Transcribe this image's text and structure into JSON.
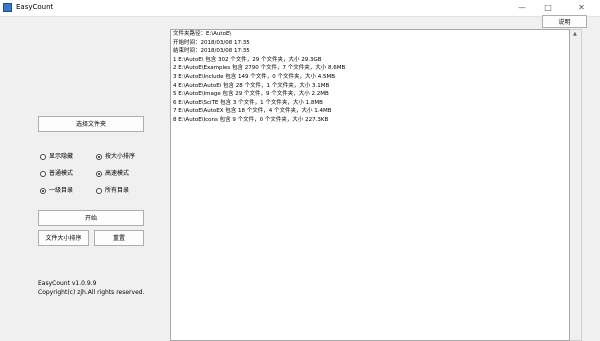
{
  "window": {
    "title": "EasyCount",
    "min_glyph": "—",
    "max_glyph": "□",
    "close_glyph": "✕"
  },
  "help_label": "说明",
  "select_folder_label": "选择文件夹",
  "options": [
    {
      "label": "显示隐藏",
      "checked": false
    },
    {
      "label": "按大小排序",
      "checked": true
    },
    {
      "label": "普通模式",
      "checked": false
    },
    {
      "label": "高速模式",
      "checked": true
    },
    {
      "label": "一级目录",
      "checked": true
    },
    {
      "label": "所有目录",
      "checked": false
    }
  ],
  "start_label": "开始",
  "export_label": "文件大小排序",
  "reset_label": "重置",
  "version": "EasyCount v1.0.9.9",
  "copyright": "Copyright(c) zjh.All rights reserved.",
  "output_lines": [
    "文件夹路径：E:\\AutoE\\",
    "开始时间：2018/03/08 17:35",
    "结束时间：2018/03/08 17:35",
    "1 E:\\AutoE\\ 包含 302 个文件，29 个文件夹，大小 29.3GB",
    "2 E:\\AutoE\\Examples 包含 2790 个文件，7 个文件夹，大小 8.6MB",
    "3 E:\\AutoE\\Include 包含 149 个文件，0 个文件夹，大小 4.5MB",
    "4 E:\\AutoE\\AutoEi 包含 28 个文件，1 个文件夹，大小 3.1MB",
    "5 E:\\AutoE\\Image 包含 29 个文件，9 个文件夹，大小 2.2MB",
    "6 E:\\AutoE\\SciTE 包含 3 个文件，1 个文件夹，大小 1.8MB",
    "7 E:\\AutoE\\AutoEX 包含 18 个文件，4 个文件夹，大小 1.4MB",
    "8 E:\\AutoE\\Icons 包含 9 个文件，0 个文件夹，大小 227.3KB"
  ]
}
